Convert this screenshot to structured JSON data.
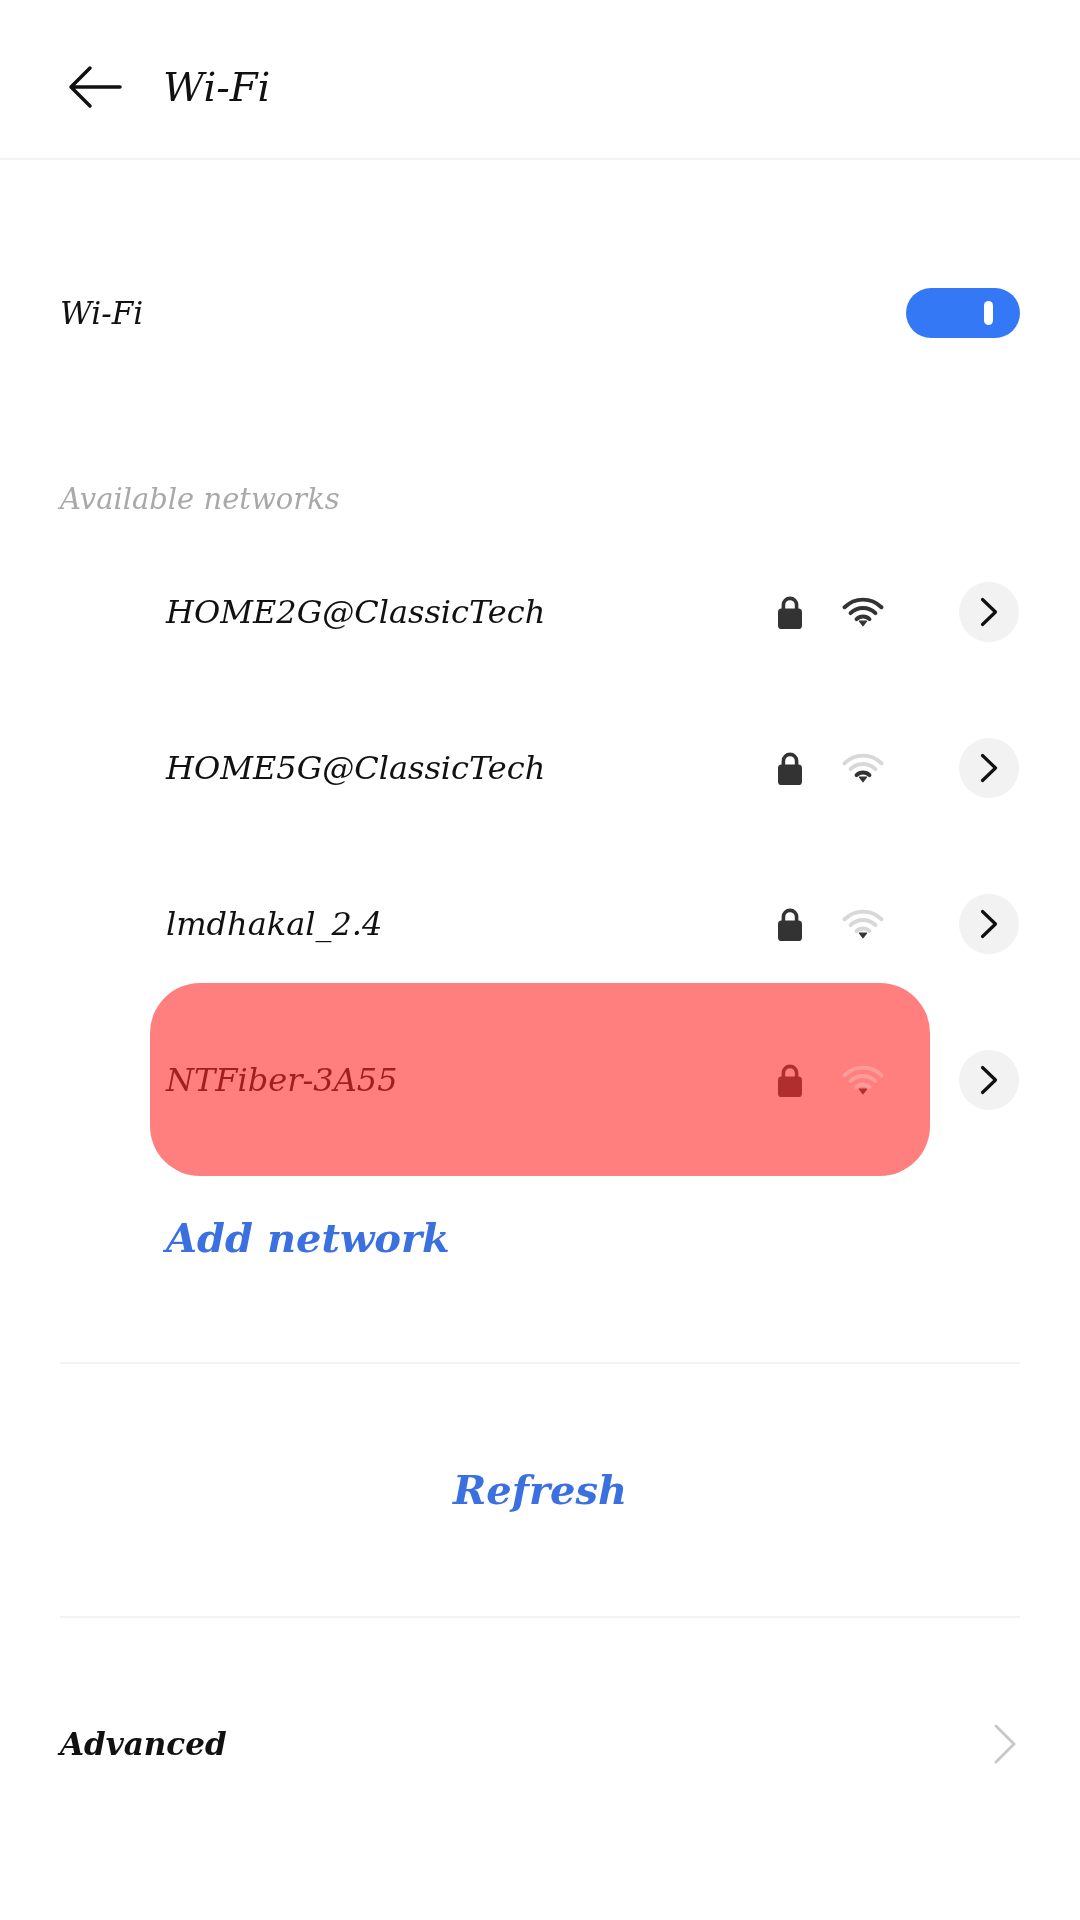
{
  "header": {
    "title": "Wi-Fi"
  },
  "wifi_toggle": {
    "label": "Wi-Fi",
    "on": true
  },
  "available_networks": {
    "heading": "Available networks",
    "networks": [
      {
        "name": "HOME2G@ClassicTech",
        "secured": true,
        "kind": "strong",
        "highlighted": false
      },
      {
        "name": "HOME5G@ClassicTech",
        "secured": true,
        "kind": "fair",
        "highlighted": false
      },
      {
        "name": "lmdhakal_2.4",
        "secured": true,
        "kind": "weak",
        "highlighted": false
      },
      {
        "name": "NTFiber-3A55",
        "secured": true,
        "kind": "weak",
        "highlighted": true
      }
    ]
  },
  "add_network": {
    "label": "Add network"
  },
  "refresh": {
    "label": "Refresh"
  },
  "advanced": {
    "label": "Advanced"
  }
}
